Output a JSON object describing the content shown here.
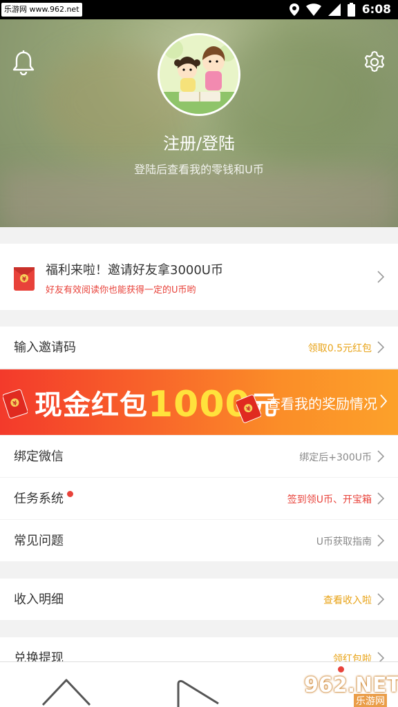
{
  "status_bar": {
    "watermark": "乐游网 www.962.net",
    "time": "6:08",
    "icons": [
      "location-icon",
      "wifi-icon",
      "signal-icon",
      "battery-icon"
    ]
  },
  "header": {
    "title": "注册/登陆",
    "subtitle": "登陆后查看我的零钱和U币",
    "icons": [
      "bell-icon",
      "gear-icon"
    ]
  },
  "invite_card": {
    "title": "福利来啦！邀请好友拿3000U币",
    "subtitle": "好友有效阅读你也能获得一定的U币哟"
  },
  "invite_code": {
    "label": "输入邀请码",
    "value": "领取0.5元红包"
  },
  "banner": {
    "left_text": "现金红包",
    "amount": "1000",
    "unit": "元",
    "right_text": "查看我的奖励情况"
  },
  "menu": [
    {
      "label": "绑定微信",
      "value": "绑定后+300U币"
    },
    {
      "label": "任务系统",
      "value": "签到领U币、开宝箱"
    },
    {
      "label": "常见问题",
      "value": "U币获取指南"
    }
  ],
  "income": {
    "label": "收入明细",
    "value": "查看收入啦"
  },
  "exchange": {
    "label": "兑换提现",
    "value": "领红包啦"
  },
  "bottom_nav": {
    "logo_main": "962.NET",
    "logo_sub": "乐游网"
  },
  "colors": {
    "accent_orange": "#e8a317",
    "accent_red": "#e8423a",
    "value_gray": "#888888"
  }
}
